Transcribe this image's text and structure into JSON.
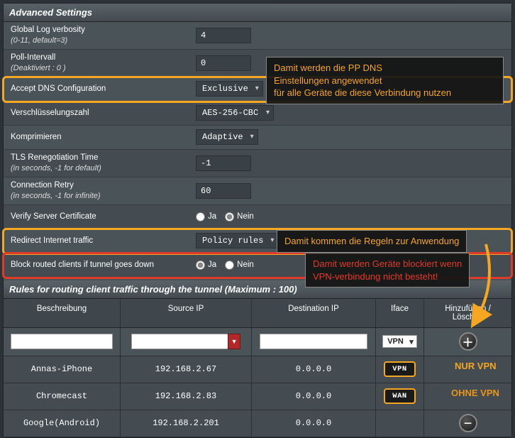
{
  "sections": {
    "advanced_title": "Advanced Settings",
    "rules_title": "Rules for routing client traffic through the tunnel (Maximum : 100)"
  },
  "settings": {
    "log_verbosity_label": "Global Log verbosity",
    "log_verbosity_sub": "(0-11, default=3)",
    "log_verbosity_value": "4",
    "poll_label": "Poll-Intervall",
    "poll_sub": "(Deaktiviert : 0 )",
    "poll_value": "0",
    "accept_dns_label": "Accept DNS Configuration",
    "accept_dns_value": "Exclusive",
    "cipher_label": "Verschlüsselungszahl",
    "cipher_value": "AES-256-CBC",
    "compress_label": "Komprimieren",
    "compress_value": "Adaptive",
    "tls_label": "TLS Renegotiation Time",
    "tls_sub": "(in seconds, -1 for default)",
    "tls_value": "-1",
    "retry_label": "Connection Retry",
    "retry_sub": "(in seconds, -1 for infinite)",
    "retry_value": "60",
    "verify_label": "Verify Server Certificate",
    "redirect_label": "Redirect Internet traffic",
    "redirect_value": "Policy rules",
    "block_label": "Block routed clients if tunnel goes down",
    "radio_yes": "Ja",
    "radio_no": "Nein"
  },
  "rules_headers": {
    "desc": "Beschreibung",
    "src": "Source IP",
    "dst": "Destination IP",
    "iface": "Iface",
    "action": "Hinzufügen / Löschen"
  },
  "rules_input": {
    "iface": "VPN"
  },
  "rules_data": [
    {
      "desc": "Annas-iPhone",
      "src": "192.168.2.67",
      "dst": "0.0.0.0",
      "iface": "VPN"
    },
    {
      "desc": "Chromecast",
      "src": "192.168.2.83",
      "dst": "0.0.0.0",
      "iface": "WAN"
    },
    {
      "desc": "Google(Android)",
      "src": "192.168.2.201",
      "dst": "0.0.0.0",
      "iface": ""
    }
  ],
  "annotations": {
    "dns_note": "Damit werden die PP DNS\nEinstellungen angewendet\nfür alle Geräte die diese Verbindung nutzen",
    "redirect_note": "Damit kommen die Regeln zur Anwendung",
    "block_note": "Damit werden Geräte blockiert wenn\nVPN-verbindung nicht besteht!",
    "nur_vpn": "NUR VPN",
    "ohne_vpn": "OHNE VPN"
  }
}
